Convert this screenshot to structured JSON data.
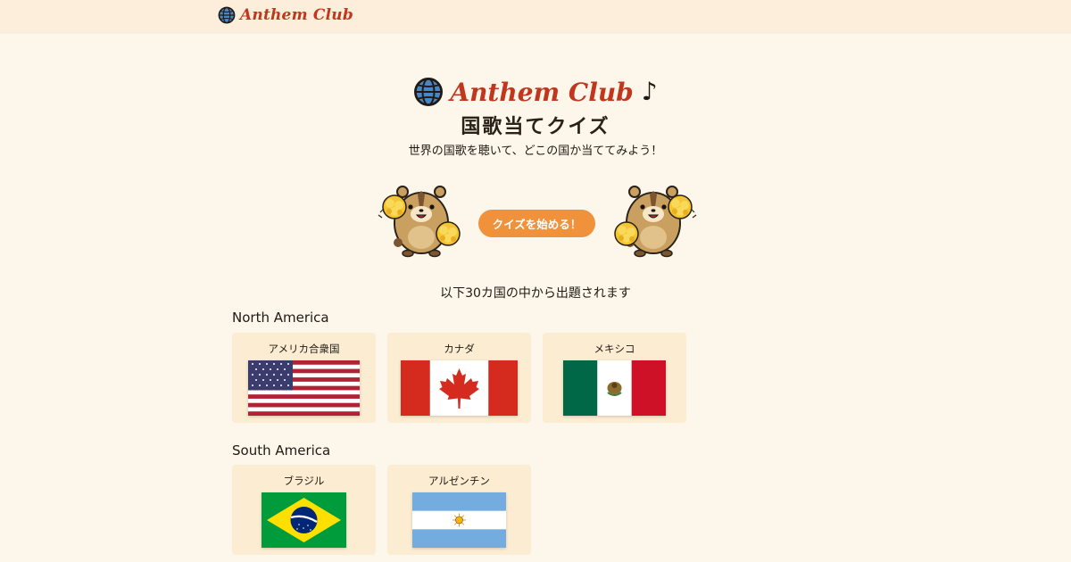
{
  "header": {
    "brand": "Anthem Club",
    "logo_icon": "globe-icon"
  },
  "hero": {
    "title": "Anthem Club",
    "title_icon": "globe-icon",
    "note_icon": "music-note-icon",
    "note_glyph": "♪",
    "subtitle": "国歌当てクイズ",
    "tagline": "世界の国歌を聴いて、どこの国か当ててみよう！",
    "start_button": "クイズを始める！",
    "mascot": "cheering-hamster"
  },
  "colors": {
    "background": "#fdf6ea",
    "header": "#fdeedb",
    "brand": "#c0371d",
    "button": "#f0913c",
    "card": "#fcecd2"
  },
  "countries_intro": "以下30カ国の中から出題されます",
  "regions": [
    {
      "name": "North America",
      "countries": [
        {
          "name": "アメリカ合衆国",
          "flag": "us-flag"
        },
        {
          "name": "カナダ",
          "flag": "canada-flag"
        },
        {
          "name": "メキシコ",
          "flag": "mexico-flag"
        }
      ]
    },
    {
      "name": "South America",
      "countries": [
        {
          "name": "ブラジル",
          "flag": "brazil-flag"
        },
        {
          "name": "アルゼンチン",
          "flag": "argentina-flag"
        }
      ]
    }
  ]
}
